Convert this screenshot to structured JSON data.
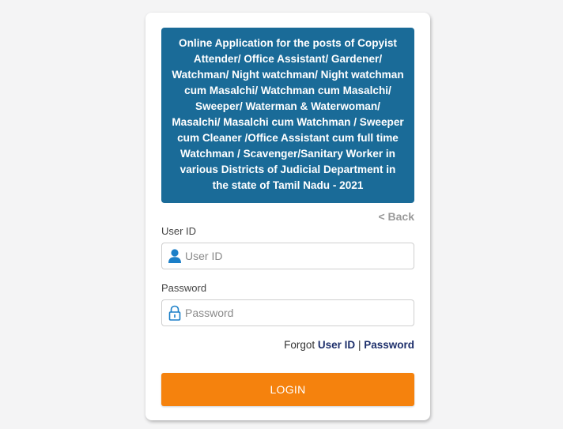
{
  "banner": {
    "title": "Online Application for the posts of Copyist Attender/ Office Assistant/ Gardener/ Watchman/ Night watchman/ Night watchman cum Masalchi/ Watchman cum Masalchi/ Sweeper/ Waterman & Waterwoman/ Masalchi/ Masalchi cum Watchman / Sweeper cum Cleaner /Office Assistant cum full time Watchman / Scavenger/Sanitary Worker in various Districts of Judicial Department in the state of Tamil Nadu - 2021"
  },
  "back_link": "< Back",
  "user_id": {
    "label": "User ID",
    "placeholder": "User ID",
    "icon": "user-icon"
  },
  "password": {
    "label": "Password",
    "placeholder": "Password",
    "icon": "lock-icon"
  },
  "forgot": {
    "prefix": "Forgot",
    "user_id_link": "User ID",
    "separator": "|",
    "password_link": "Password"
  },
  "login_button": "LOGIN",
  "colors": {
    "banner_bg": "#1a6b98",
    "button_bg": "#f5820d",
    "icon_blue": "#1b7fc8",
    "link_navy": "#1d2f6b"
  }
}
